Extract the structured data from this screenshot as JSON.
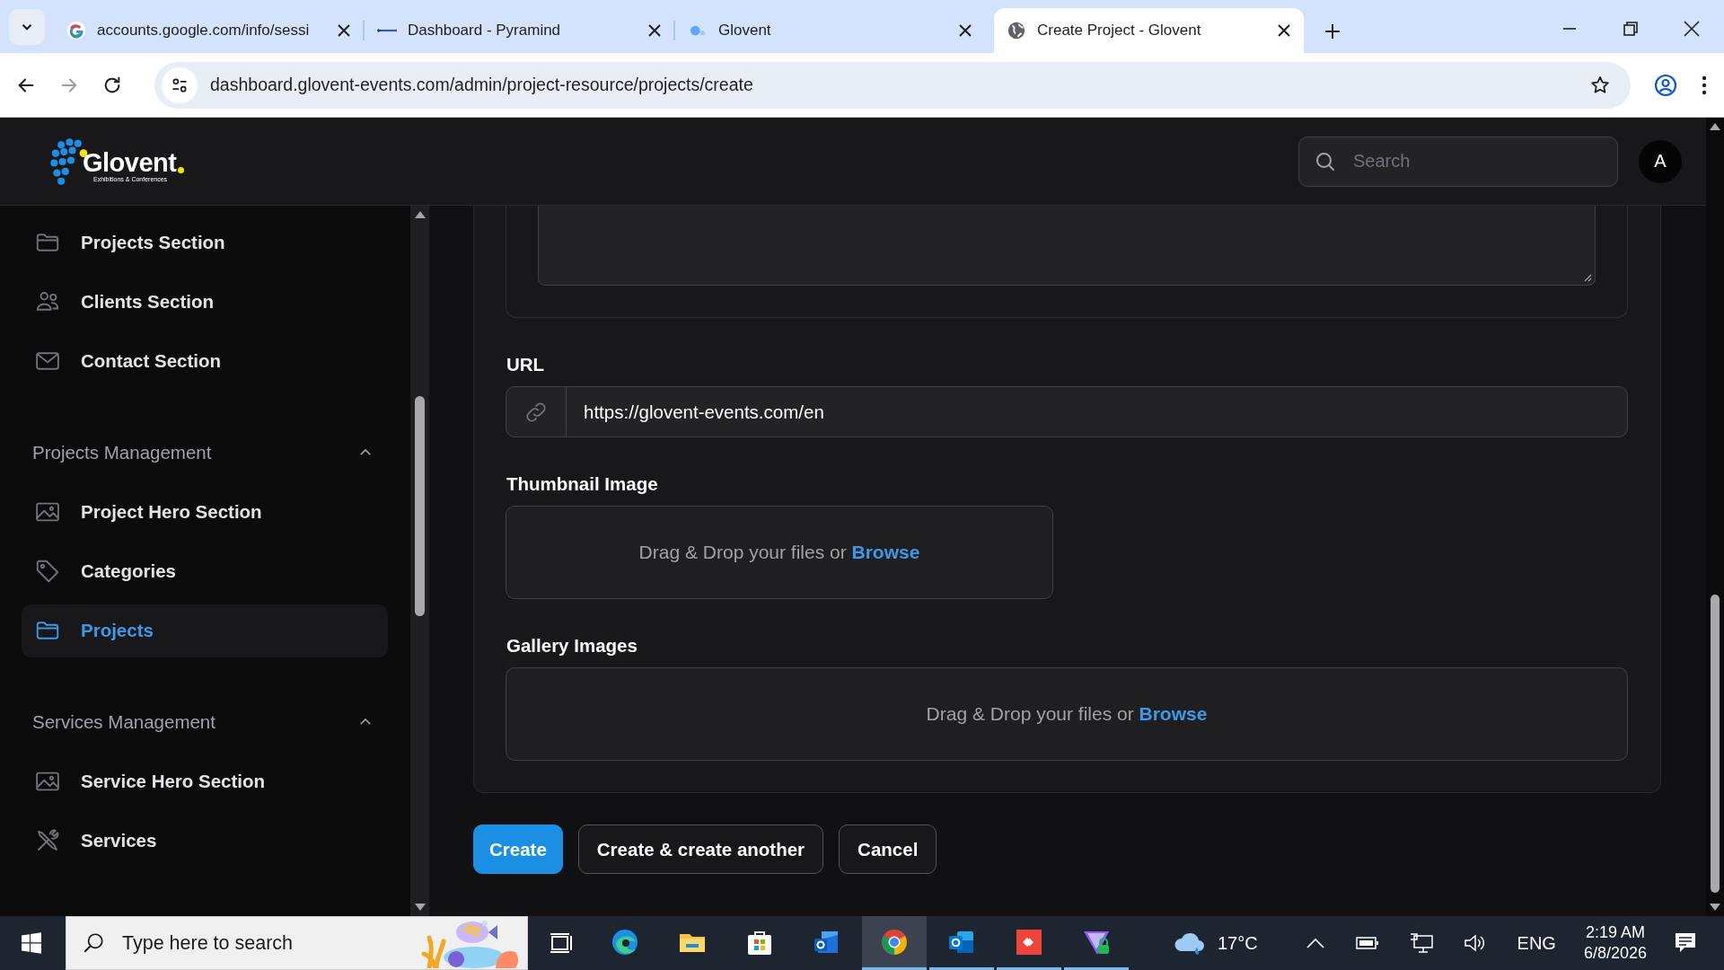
{
  "browser": {
    "tabs": [
      {
        "title": "accounts.google.com/info/sessi",
        "selected": false
      },
      {
        "title": "Dashboard - Pyramind",
        "selected": false
      },
      {
        "title": "Glovent",
        "selected": false
      },
      {
        "title": "Create Project - Glovent",
        "selected": true
      }
    ],
    "address": "dashboard.glovent-events.com/admin/project-resource/projects/create"
  },
  "header": {
    "logo": "Glovent",
    "logo_tagline": "Exhibitions & Conferences",
    "search": {
      "placeholder": "Search"
    },
    "avatar": "A"
  },
  "sidebar": {
    "items": [
      {
        "label": "Projects Section",
        "selected": false
      },
      {
        "label": "Clients Section",
        "selected": false
      },
      {
        "label": "Contact Section",
        "selected": false
      }
    ],
    "groups": [
      {
        "label": "Projects Management",
        "expanded": true,
        "items": [
          {
            "label": "Project Hero Section",
            "selected": false
          },
          {
            "label": "Categories",
            "selected": false
          },
          {
            "label": "Projects",
            "selected": true
          }
        ]
      },
      {
        "label": "Services Management",
        "expanded": true,
        "items": [
          {
            "label": "Service Hero Section",
            "selected": false
          },
          {
            "label": "Services",
            "selected": false
          }
        ]
      }
    ]
  },
  "form": {
    "url": {
      "label": "URL",
      "value": "https://glovent-events.com/en"
    },
    "uploads": [
      {
        "label": "Thumbnail Image",
        "prompt": "Drag & Drop your files or",
        "link": "Browse"
      },
      {
        "label": "Gallery Images",
        "prompt": "Drag & Drop your files or",
        "link": "Browse"
      }
    ],
    "buttons": [
      {
        "label": "Create",
        "kind": "primary"
      },
      {
        "label": "Create & create another",
        "kind": "secondary"
      },
      {
        "label": "Cancel",
        "kind": "secondary"
      }
    ]
  },
  "taskbar": {
    "search": {
      "placeholder": "Type here to search"
    },
    "apps": [
      {
        "running": false,
        "selected": false
      },
      {
        "running": false,
        "selected": false
      },
      {
        "running": false,
        "selected": false
      },
      {
        "running": false,
        "selected": false
      },
      {
        "running": true,
        "selected": true
      },
      {
        "running": true,
        "selected": false
      },
      {
        "running": true,
        "selected": false
      },
      {
        "running": true,
        "selected": false
      }
    ],
    "weather": "17°C",
    "language": "ENG",
    "time": "2:19 AM",
    "date": "6/8/2026"
  }
}
